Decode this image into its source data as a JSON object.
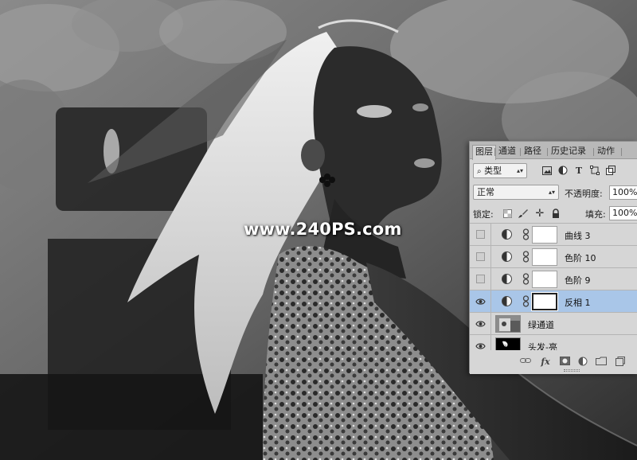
{
  "watermark": "www.240PS.com",
  "panel": {
    "tabs": [
      "图层",
      "通道",
      "路径",
      "历史记录",
      "动作"
    ],
    "active_tab": "图层",
    "filter": {
      "label": "类型",
      "icon": "search-icon"
    },
    "blend_mode": "正常",
    "opacity": {
      "label": "不透明度:",
      "value": "100%"
    },
    "lock": {
      "label": "锁定:"
    },
    "fill": {
      "label": "填充:",
      "value": "100%"
    },
    "layers": [
      {
        "name": "曲线 3",
        "type": "adjustment",
        "visible": false,
        "selected": false
      },
      {
        "name": "色阶 10",
        "type": "adjustment",
        "visible": false,
        "selected": false
      },
      {
        "name": "色阶 9",
        "type": "adjustment",
        "visible": false,
        "selected": false
      },
      {
        "name": "反相 1",
        "type": "adjustment",
        "visible": true,
        "selected": true
      },
      {
        "name": "绿通道",
        "type": "image",
        "visible": true,
        "selected": false
      },
      {
        "name": "头发-亮",
        "type": "image",
        "visible": true,
        "selected": false
      }
    ],
    "bottom_icons": [
      "link-icon",
      "fx-icon",
      "mask-icon",
      "adjustment-icon",
      "folder-icon",
      "new-layer-icon"
    ],
    "colors": {
      "panel_bg": "#d6d6d6",
      "selected_row": "#a9c6e8",
      "tab_bar": "#b9b9b9"
    }
  }
}
